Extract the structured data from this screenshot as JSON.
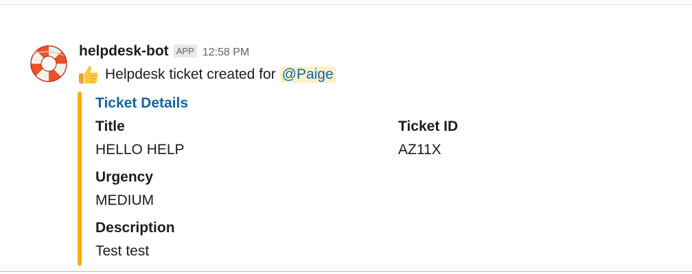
{
  "message": {
    "sender": "helpdesk-bot",
    "badge": "APP",
    "time": "12:58 PM",
    "avatar_icon": "life-ring-icon",
    "emoji_icon": "thumbs-up-icon",
    "text": "Helpdesk ticket created for",
    "mention": "@Paige"
  },
  "attachment": {
    "accent_color": "#f8aa07",
    "title": "Ticket Details",
    "fields": [
      {
        "label": "Title",
        "value": "HELLO HELP"
      },
      {
        "label": "Ticket ID",
        "value": "AZ11X"
      },
      {
        "label": "Urgency",
        "value": "MEDIUM"
      },
      {
        "label": "Description",
        "value": "Test test"
      }
    ]
  }
}
